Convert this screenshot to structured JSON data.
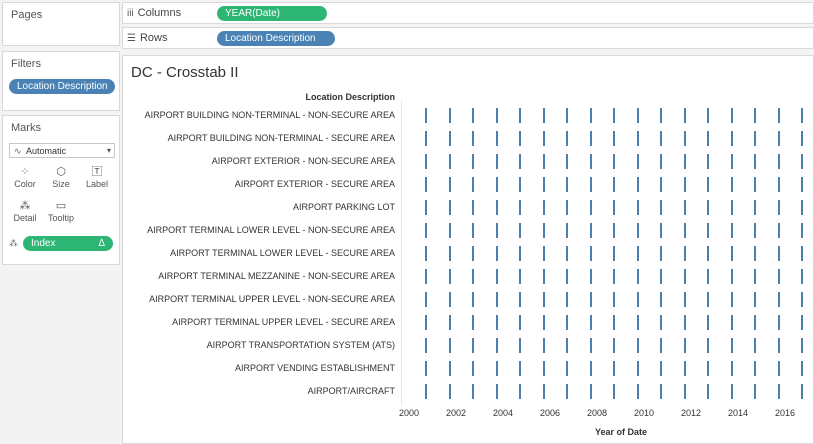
{
  "sidebar": {
    "pages_title": "Pages",
    "filters_title": "Filters",
    "filter_pill": "Location Description",
    "marks_title": "Marks",
    "mark_type": "Automatic",
    "mark_buttons": [
      {
        "label": "Color",
        "icon": "color-dots-icon"
      },
      {
        "label": "Size",
        "icon": "size-icon"
      },
      {
        "label": "Label",
        "icon": "label-icon"
      },
      {
        "label": "Detail",
        "icon": "detail-icon"
      },
      {
        "label": "Tooltip",
        "icon": "tooltip-icon"
      }
    ],
    "index_pill": "Index",
    "index_pill_suffix": "Δ"
  },
  "shelves": {
    "columns_label": "Columns",
    "columns_pill": "YEAR(Date)",
    "rows_label": "Rows",
    "rows_pill": "Location Description"
  },
  "colors": {
    "blue_pill": "#4a82b5",
    "green_pill": "#2db574",
    "mark": "#4a7fae"
  },
  "view": {
    "title": "DC - Crosstab II",
    "row_header": "Location Description"
  },
  "chart_data": {
    "type": "table",
    "xlabel": "Year of Date",
    "ylabel": "Location Description",
    "columns": [
      "2000",
      "2001",
      "2002",
      "2003",
      "2004",
      "2005",
      "2006",
      "2007",
      "2008",
      "2009",
      "2010",
      "2011",
      "2012",
      "2013",
      "2014",
      "2015",
      "2016",
      "2017"
    ],
    "tick_labels": [
      "2000",
      "2002",
      "2004",
      "2006",
      "2008",
      "2010",
      "2012",
      "2014",
      "2016"
    ],
    "rows": [
      "AIRPORT BUILDING NON-TERMINAL - NON-SECURE AREA",
      "AIRPORT BUILDING NON-TERMINAL - SECURE AREA",
      "AIRPORT EXTERIOR - NON-SECURE AREA",
      "AIRPORT EXTERIOR - SECURE AREA",
      "AIRPORT PARKING LOT",
      "AIRPORT TERMINAL LOWER LEVEL - NON-SECURE AREA",
      "AIRPORT TERMINAL LOWER LEVEL - SECURE AREA",
      "AIRPORT TERMINAL MEZZANINE - NON-SECURE AREA",
      "AIRPORT TERMINAL UPPER LEVEL - NON-SECURE AREA",
      "AIRPORT TERMINAL UPPER LEVEL - SECURE AREA",
      "AIRPORT TRANSPORTATION SYSTEM (ATS)",
      "AIRPORT VENDING ESTABLISHMENT",
      "AIRPORT/AIRCRAFT"
    ]
  }
}
